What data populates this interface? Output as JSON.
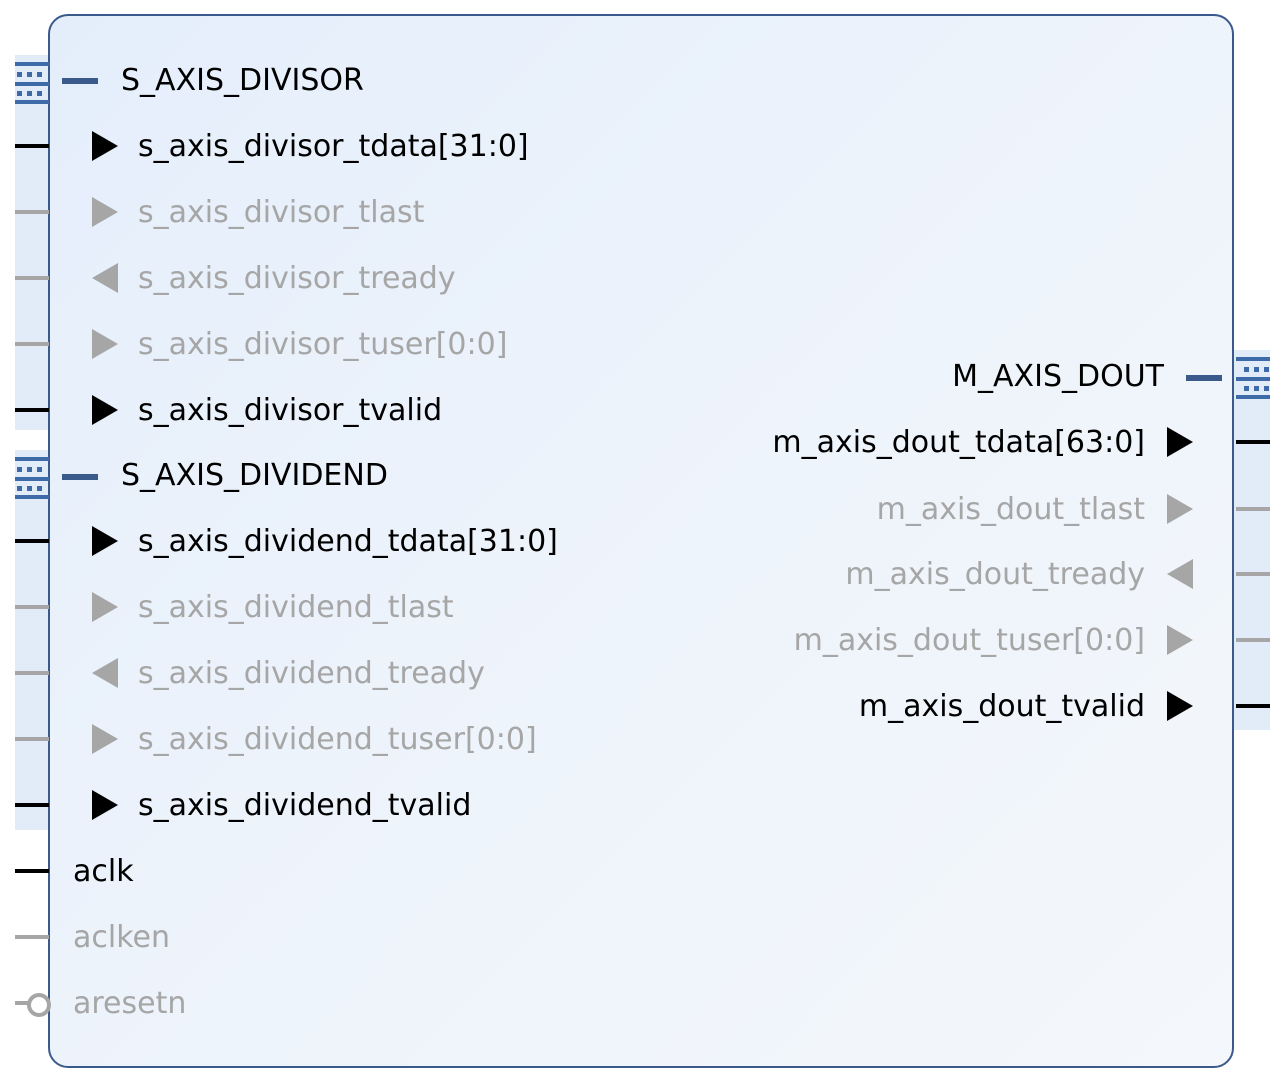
{
  "block": {
    "interfaces": {
      "s_axis_divisor": {
        "name": "S_AXIS_DIVISOR",
        "signals": [
          {
            "label": "s_axis_divisor_tdata[31:0]",
            "dir": "in",
            "active": true
          },
          {
            "label": "s_axis_divisor_tlast",
            "dir": "in",
            "active": false
          },
          {
            "label": "s_axis_divisor_tready",
            "dir": "out",
            "active": false
          },
          {
            "label": "s_axis_divisor_tuser[0:0]",
            "dir": "in",
            "active": false
          },
          {
            "label": "s_axis_divisor_tvalid",
            "dir": "in",
            "active": true
          }
        ]
      },
      "s_axis_dividend": {
        "name": "S_AXIS_DIVIDEND",
        "signals": [
          {
            "label": "s_axis_dividend_tdata[31:0]",
            "dir": "in",
            "active": true
          },
          {
            "label": "s_axis_dividend_tlast",
            "dir": "in",
            "active": false
          },
          {
            "label": "s_axis_dividend_tready",
            "dir": "out",
            "active": false
          },
          {
            "label": "s_axis_dividend_tuser[0:0]",
            "dir": "in",
            "active": false
          },
          {
            "label": "s_axis_dividend_tvalid",
            "dir": "in",
            "active": true
          }
        ]
      },
      "m_axis_dout": {
        "name": "M_AXIS_DOUT",
        "signals": [
          {
            "label": "m_axis_dout_tdata[63:0]",
            "dir": "out",
            "active": true
          },
          {
            "label": "m_axis_dout_tlast",
            "dir": "out",
            "active": false
          },
          {
            "label": "m_axis_dout_tready",
            "dir": "in",
            "active": false
          },
          {
            "label": "m_axis_dout_tuser[0:0]",
            "dir": "out",
            "active": false
          },
          {
            "label": "m_axis_dout_tvalid",
            "dir": "out",
            "active": true
          }
        ]
      }
    },
    "ports": [
      {
        "label": "aclk",
        "active": true,
        "type": "clock"
      },
      {
        "label": "aclken",
        "active": false,
        "type": "enable"
      },
      {
        "label": "aresetn",
        "active": false,
        "type": "reset-active-low"
      }
    ]
  },
  "colors": {
    "border": "#3b5a8c",
    "interface_accent": "#3f6aa8",
    "active": "#000000",
    "inactive": "#a6a6a6"
  }
}
